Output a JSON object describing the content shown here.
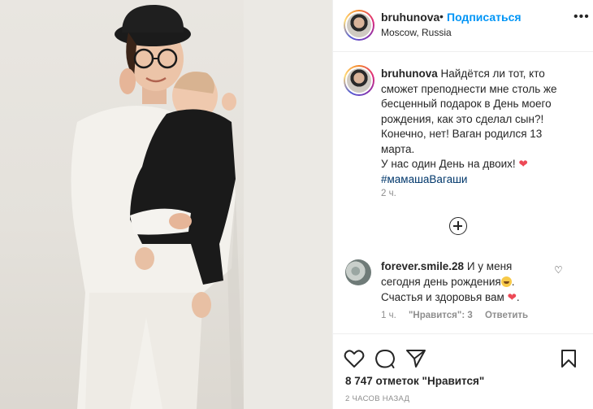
{
  "post": {
    "username": "bruhunova",
    "separator": "•",
    "follow_label": "Подписаться",
    "location": "Moscow, Russia",
    "more_label": "•••"
  },
  "caption": {
    "username": "bruhunova",
    "text_1": "Найдётся ли тот, кто сможет преподнести мне столь же бесценный подарок в День моего рождения, как это сделал сын?! Конечно, нет! Ваган родился 13 марта.",
    "text_2": "У нас один День на двоих!",
    "heart": "❤",
    "hashtag": "#мамашаВагаши",
    "time": "2 ч."
  },
  "comment": {
    "username": "forever.smile.28",
    "text_1": "И у меня сегодня день рождения",
    "text_2": ".",
    "text_3": "Счастья и здоровья вам",
    "heart": "❤",
    "text_4": ".",
    "time": "1 ч.",
    "likes": "\"Нравится\": 3",
    "reply_label": "Ответить",
    "like_icon": "♡"
  },
  "stats": {
    "likes": "8 747 отметок \"Нравится\"",
    "posted_ago": "2 ЧАСОВ НАЗАД"
  },
  "colors": {
    "accent": "#0095f6",
    "heart": "#ed4956",
    "hashtag": "#00376b",
    "secondary_text": "#8e8e8e"
  },
  "icons": {
    "like": "heart-icon",
    "comment": "comment-icon",
    "share": "paper-plane-icon",
    "save": "bookmark-icon",
    "load_more": "plus-circle-icon"
  }
}
